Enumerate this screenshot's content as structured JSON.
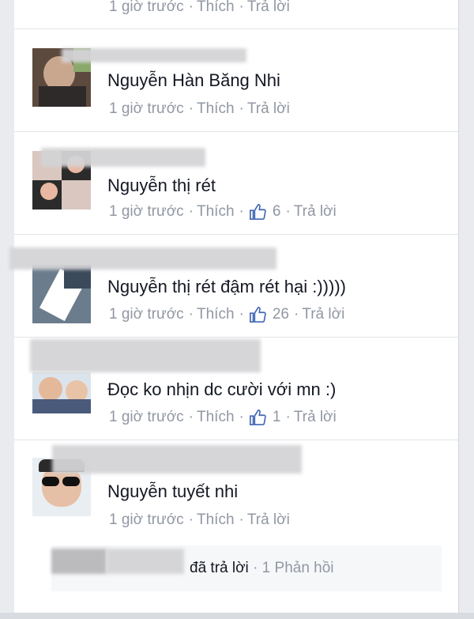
{
  "top_meta": {
    "time": "1 giờ trước",
    "like": "Thích",
    "reply": "Trả lời"
  },
  "comments": [
    {
      "text": "Nguyễn Hàn Băng Nhi",
      "time": "1 giờ trước",
      "like": "Thích",
      "reply": "Trả lời",
      "likes": ""
    },
    {
      "text": "Nguyễn thị rét",
      "time": "1 giờ trước",
      "like": "Thích",
      "reply": "Trả lời",
      "likes": "6"
    },
    {
      "text": "Nguyễn thị rét đậm rét hại :)))))",
      "time": "1 giờ trước",
      "like": "Thích",
      "reply": "Trả lời",
      "likes": "26"
    },
    {
      "text": "Đọc ko nhịn dc cười với mn :)",
      "time": "1 giờ trước",
      "like": "Thích",
      "reply": "Trả lời",
      "likes": "1"
    },
    {
      "text": "Nguyễn tuyết nhi",
      "time": "1 giờ trước",
      "like": "Thích",
      "reply": "Trả lời",
      "likes": ""
    }
  ],
  "reply_summary": {
    "action": "đã trả lời",
    "separator": "·",
    "count": "1 Phản hồi"
  },
  "colors": {
    "meta": "#9197a3",
    "like_thumb": "#4267b2",
    "text": "#141823"
  }
}
